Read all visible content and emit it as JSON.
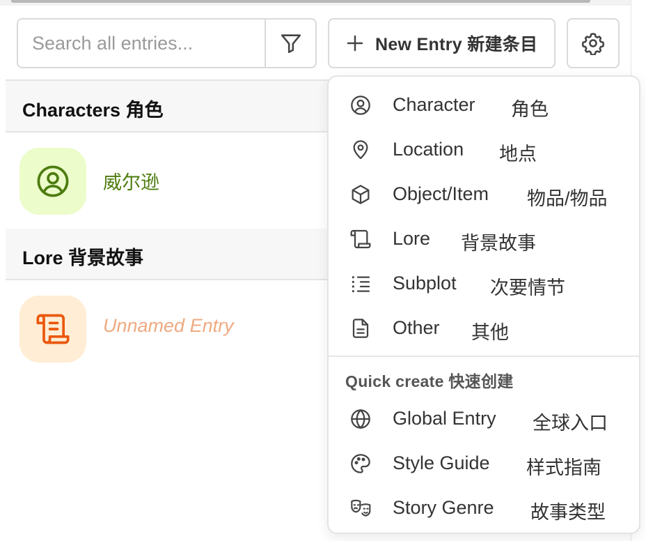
{
  "toolbar": {
    "search_placeholder": "Search all entries...",
    "new_entry_label": "New Entry  新建条目"
  },
  "sections": [
    {
      "title": "Characters  角色",
      "entries": [
        {
          "name": "威尔逊",
          "icon": "user-circle-icon",
          "color": "#4d7c0f",
          "bg": "#ecfccb"
        }
      ]
    },
    {
      "title": "Lore  背景故事",
      "entries": [
        {
          "name": "Unnamed Entry",
          "icon": "scroll-icon",
          "color": "#ea580c",
          "bg": "#ffedd5"
        }
      ]
    }
  ],
  "new_entry_menu": {
    "items": [
      {
        "en": "Character",
        "zh": "角色",
        "icon": "user-circle-icon"
      },
      {
        "en": "Location",
        "zh": "地点",
        "icon": "map-pin-icon"
      },
      {
        "en": "Object/Item",
        "zh": "物品/物品",
        "icon": "cube-icon"
      },
      {
        "en": "Lore",
        "zh": "背景故事",
        "icon": "scroll-icon"
      },
      {
        "en": "Subplot",
        "zh": "次要情节",
        "icon": "list-tree-icon"
      },
      {
        "en": "Other",
        "zh": "其他",
        "icon": "file-text-icon"
      }
    ],
    "quick_create_label": "Quick create  快速创建",
    "quick_items": [
      {
        "en": "Global Entry",
        "zh": "全球入口",
        "icon": "globe-icon"
      },
      {
        "en": "Style Guide",
        "zh": "样式指南",
        "icon": "palette-icon"
      },
      {
        "en": "Story Genre",
        "zh": "故事类型",
        "icon": "drama-masks-icon"
      }
    ]
  }
}
